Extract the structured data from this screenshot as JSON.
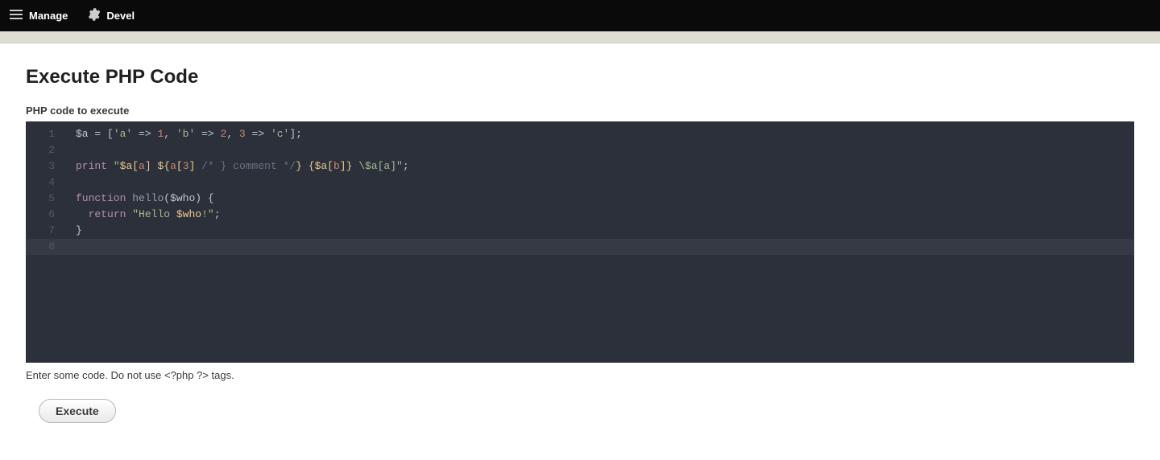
{
  "toolbar": {
    "manage_label": "Manage",
    "devel_label": "Devel"
  },
  "page": {
    "title": "Execute PHP Code",
    "field_label": "PHP code to execute",
    "help_text": "Enter some code. Do not use <?php  ?> tags.",
    "execute_label": "Execute"
  },
  "editor": {
    "line_numbers": [
      "1",
      "2",
      "3",
      "4",
      "5",
      "6",
      "7",
      "8"
    ],
    "code": {
      "line1": {
        "var": "$a",
        "eq": " = ",
        "lb": "[",
        "s1": "'a'",
        "ar1": " => ",
        "n1": "1",
        "c1": ", ",
        "s2": "'b'",
        "ar2": " => ",
        "n2": "2",
        "c2": ", ",
        "n3": "3",
        "ar3": " => ",
        "s3": "'c'",
        "rb": "];"
      },
      "line3": {
        "kw": "print",
        "sp": " ",
        "q1": "\"",
        "p1": "$a[",
        "i1": "a",
        "p2": "] ",
        "p3": "${",
        "i2": "a",
        "p4": "[",
        "i3": "3",
        "p5": "]",
        "sp2": " ",
        "cm": "/* } comment */",
        "p6": "} {",
        "p7": "$a[",
        "i4": "b",
        "p8": "]} ",
        "esc": "\\$a[a]",
        "q2": "\"",
        "end": ";"
      },
      "line5": {
        "kw": "function",
        "sp": " ",
        "fn": "hello",
        "lp": "(",
        "arg": "$who",
        "rp": ") {"
      },
      "line6": {
        "indent": "  ",
        "kw": "return",
        "sp": " ",
        "q1": "\"",
        "s1": "Hello ",
        "v": "$who",
        "s2": "!",
        "q2": "\"",
        "end": ";"
      },
      "line7": {
        "brace": "}"
      }
    }
  }
}
